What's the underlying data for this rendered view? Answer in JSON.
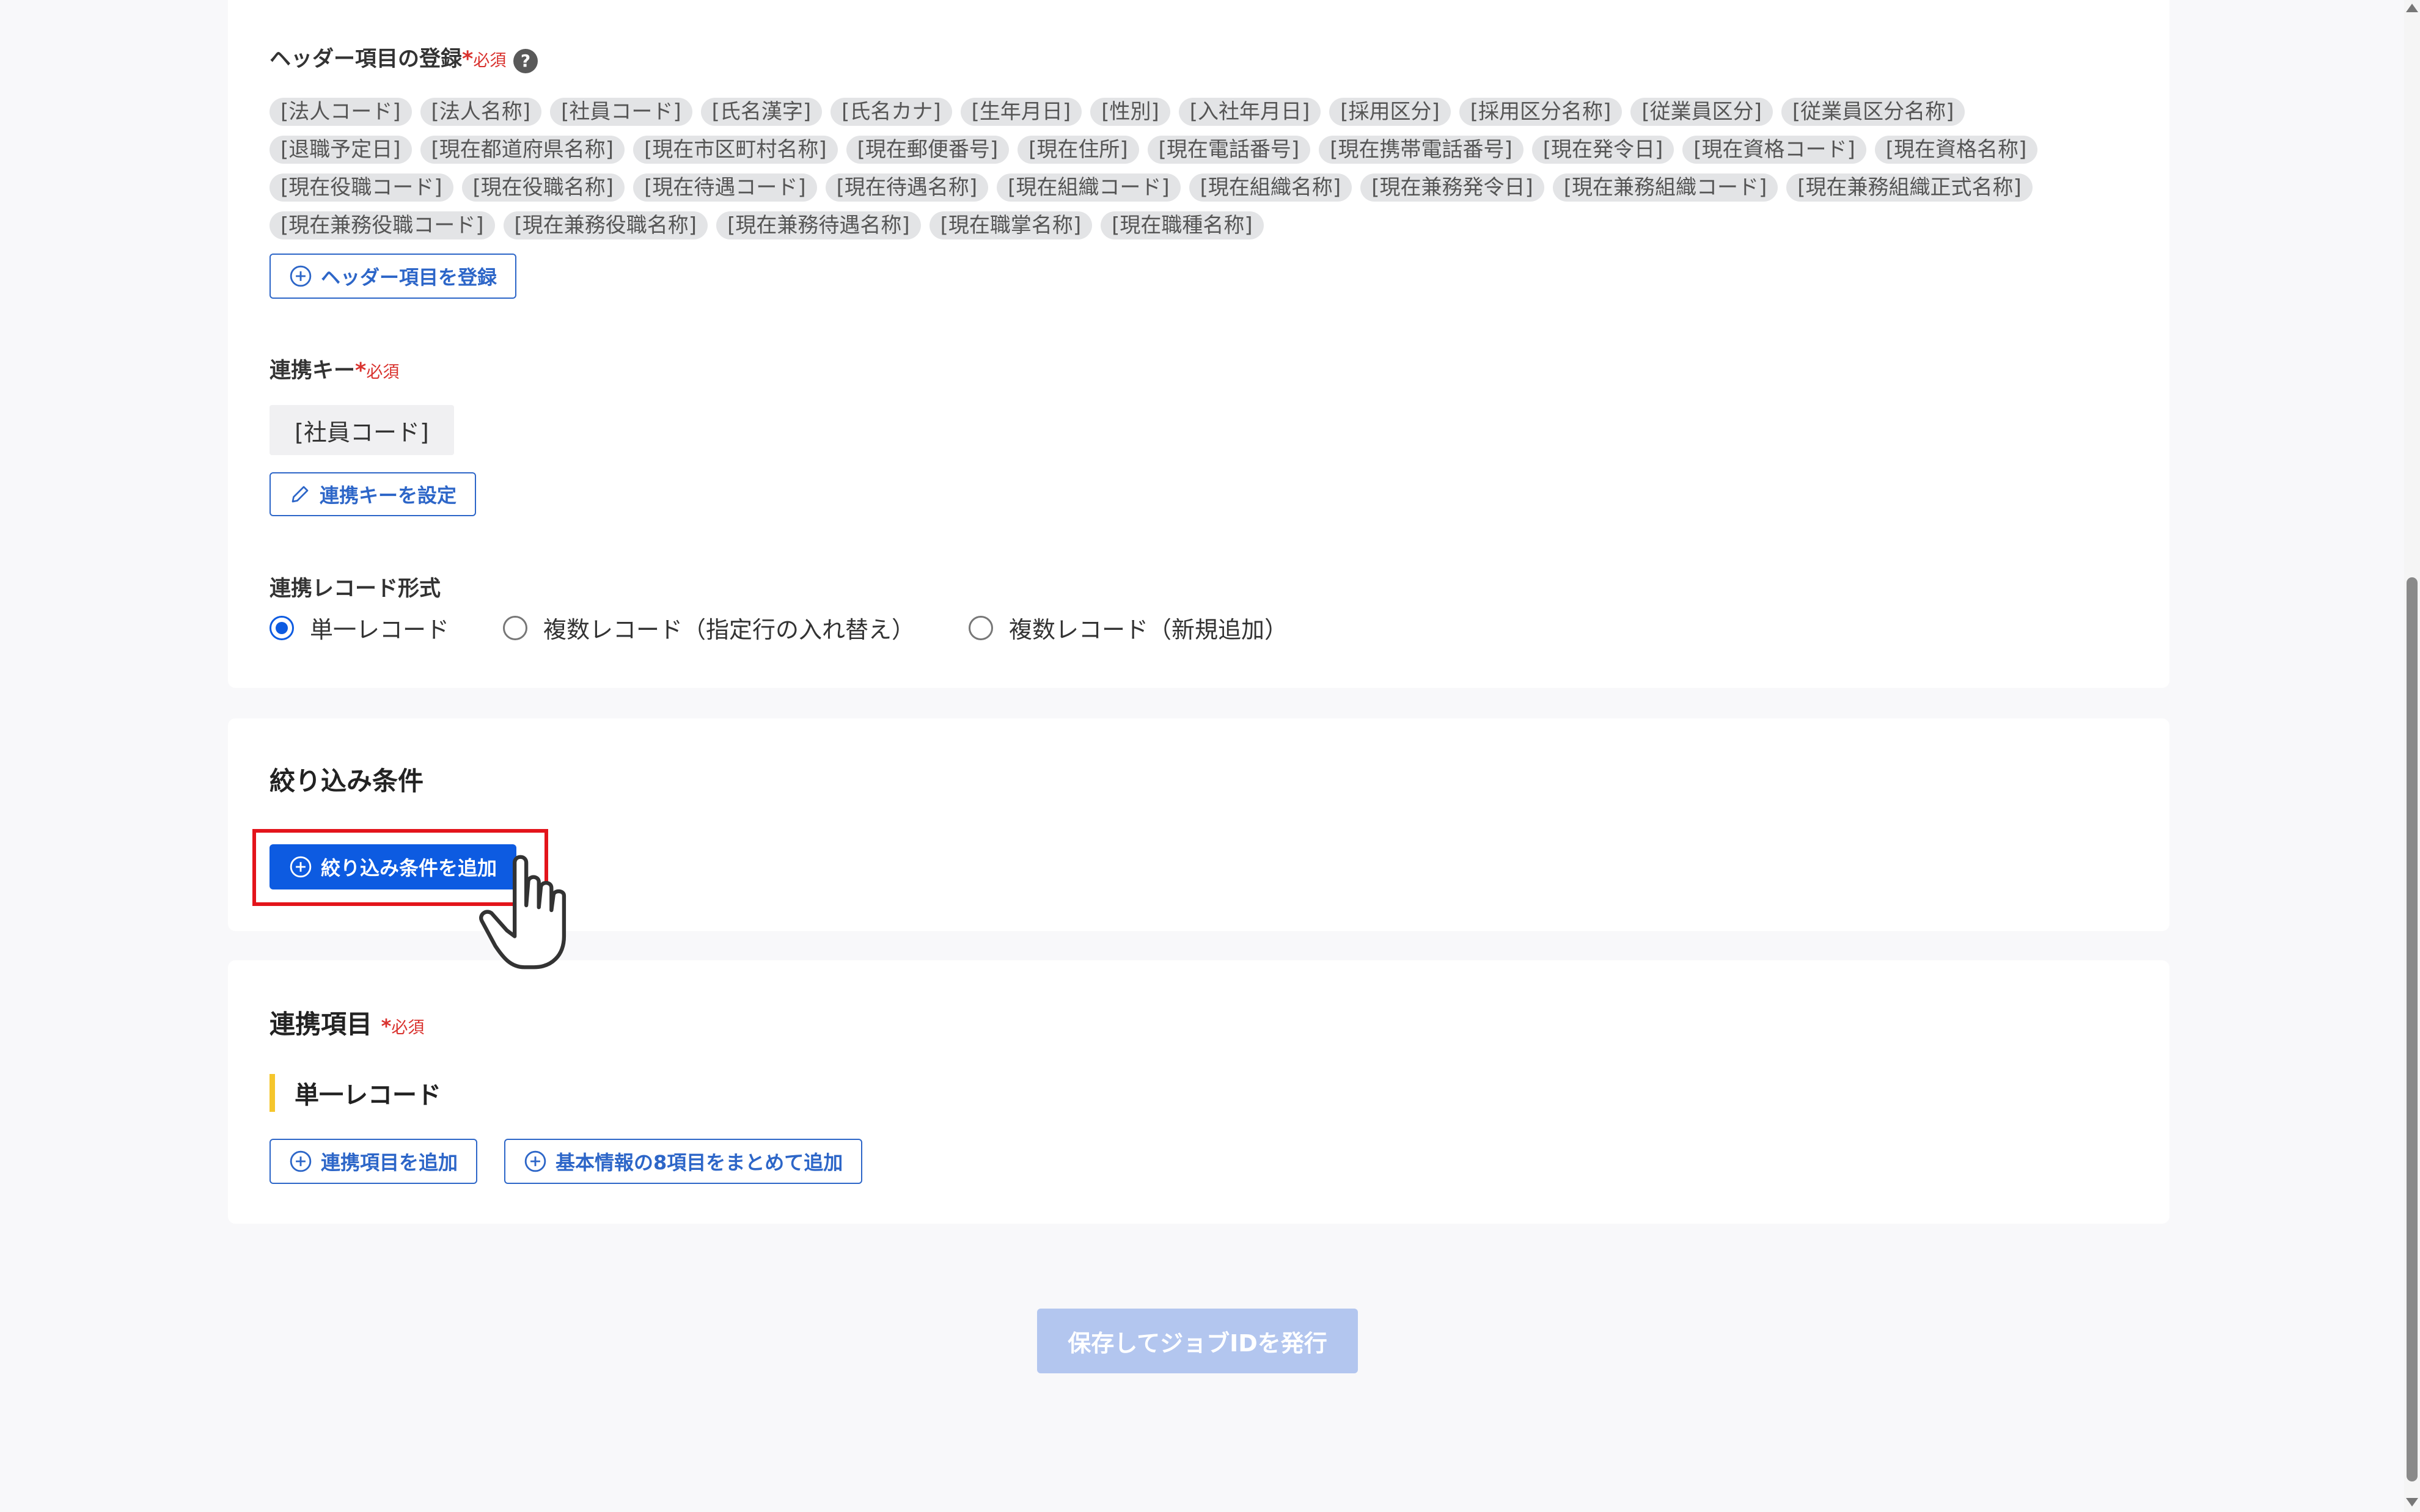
{
  "header_section": {
    "label": "ヘッダー項目の登録",
    "required_mark": "*",
    "required_text": "必須",
    "help_icon": "?",
    "chips": [
      [
        "[法人コード]",
        "[法人名称]",
        "[社員コード]",
        "[氏名漢字]",
        "[氏名カナ]",
        "[生年月日]",
        "[性別]",
        "[入社年月日]",
        "[採用区分]",
        "[採用区分名称]",
        "[従業員区分]",
        "[従業員区分名称]"
      ],
      [
        "[退職予定日]",
        "[現在都道府県名称]",
        "[現在市区町村名称]",
        "[現在郵便番号]",
        "[現在住所]",
        "[現在電話番号]",
        "[現在携帯電話番号]",
        "[現在発令日]",
        "[現在資格コード]",
        "[現在資格名称]"
      ],
      [
        "[現在役職コード]",
        "[現在役職名称]",
        "[現在待遇コード]",
        "[現在待遇名称]",
        "[現在組織コード]",
        "[現在組織名称]",
        "[現在兼務発令日]",
        "[現在兼務組織コード]",
        "[現在兼務組織正式名称]"
      ],
      [
        "[現在兼務役職コード]",
        "[現在兼務役職名称]",
        "[現在兼務待遇名称]",
        "[現在職掌名称]",
        "[現在職種名称]"
      ]
    ],
    "register_button": "ヘッダー項目を登録"
  },
  "link_key": {
    "label": "連携キー",
    "required_mark": "*",
    "required_text": "必須",
    "value": "[社員コード]",
    "set_button": "連携キーを設定"
  },
  "record_format": {
    "label": "連携レコード形式",
    "options": [
      "単一レコード",
      "複数レコード（指定行の入れ替え）",
      "複数レコード（新規追加）"
    ],
    "selected_index": 0
  },
  "filter": {
    "title": "絞り込み条件",
    "add_button": "絞り込み条件を追加"
  },
  "link_items": {
    "title": "連携項目",
    "required_mark": "*",
    "required_text": "必須",
    "subheading": "単一レコード",
    "add_button": "連携項目を追加",
    "add_basic_button": "基本情報の8項目をまとめて追加"
  },
  "footer": {
    "save_button": "保存してジョブIDを発行"
  },
  "colors": {
    "primary": "#0d5be1",
    "outline": "#2d66c8",
    "required": "#d9322e",
    "highlight": "#e3141b",
    "accent_bar": "#f5c62c",
    "disabled": "#b3c6ef"
  },
  "icons": {
    "plus": "plus-circle-icon",
    "pencil": "pencil-icon",
    "help": "question-icon",
    "cursor": "hand-pointer-icon"
  }
}
